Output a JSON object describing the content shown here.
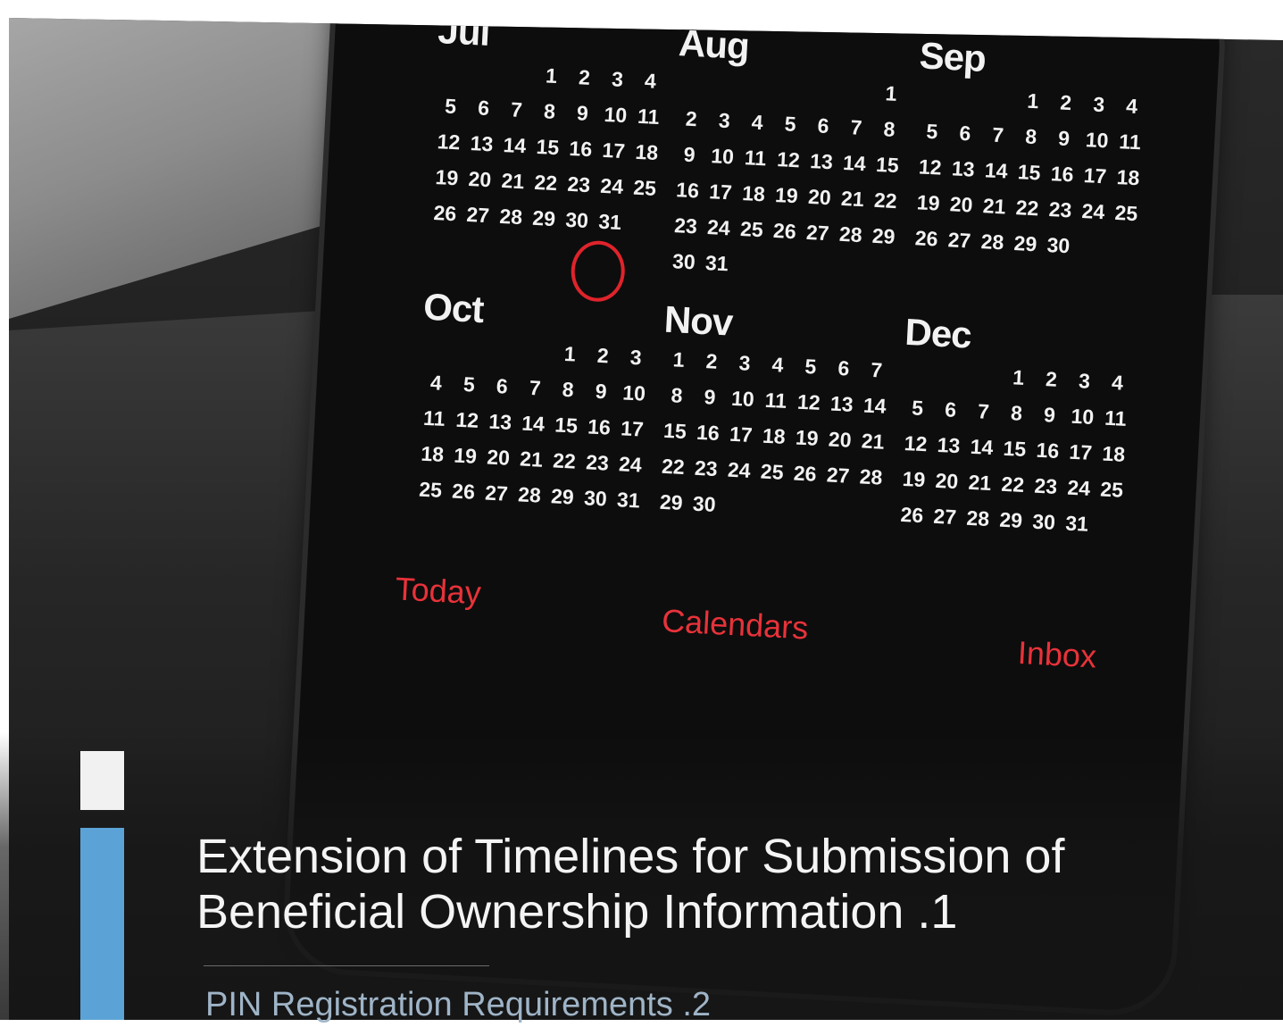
{
  "calendar": {
    "months": [
      {
        "id": "jul",
        "name": "Jul",
        "weeks": [
          [
            "",
            "",
            "",
            "1",
            "2",
            "3",
            "4"
          ],
          [
            "5",
            "6",
            "7",
            "8",
            "9",
            "10",
            "11"
          ],
          [
            "12",
            "13",
            "14",
            "15",
            "16",
            "17",
            "18"
          ],
          [
            "19",
            "20",
            "21",
            "22",
            "23",
            "24",
            "25"
          ],
          [
            "26",
            "27",
            "28",
            "29",
            "30",
            "31",
            ""
          ]
        ]
      },
      {
        "id": "aug",
        "name": "Aug",
        "weeks": [
          [
            "",
            "",
            "",
            "",
            "",
            "",
            "1"
          ],
          [
            "2",
            "3",
            "4",
            "5",
            "6",
            "7",
            "8"
          ],
          [
            "9",
            "10",
            "11",
            "12",
            "13",
            "14",
            "15"
          ],
          [
            "16",
            "17",
            "18",
            "19",
            "20",
            "21",
            "22"
          ],
          [
            "23",
            "24",
            "25",
            "26",
            "27",
            "28",
            "29"
          ],
          [
            "30",
            "31",
            "",
            "",
            "",
            "",
            ""
          ]
        ]
      },
      {
        "id": "sep",
        "name": "Sep",
        "weeks": [
          [
            "",
            "",
            "",
            "1",
            "2",
            "3",
            "4"
          ],
          [
            "5",
            "6",
            "7",
            "8",
            "9",
            "10",
            "11"
          ],
          [
            "12",
            "13",
            "14",
            "15",
            "16",
            "17",
            "18"
          ],
          [
            "19",
            "20",
            "21",
            "22",
            "23",
            "24",
            "25"
          ],
          [
            "26",
            "27",
            "28",
            "29",
            "30",
            "",
            ""
          ]
        ]
      },
      {
        "id": "oct",
        "name": "Oct",
        "weeks": [
          [
            "",
            "",
            "",
            "",
            "1",
            "2",
            "3"
          ],
          [
            "4",
            "5",
            "6",
            "7",
            "8",
            "9",
            "10"
          ],
          [
            "11",
            "12",
            "13",
            "14",
            "15",
            "16",
            "17"
          ],
          [
            "18",
            "19",
            "20",
            "21",
            "22",
            "23",
            "24"
          ],
          [
            "25",
            "26",
            "27",
            "28",
            "29",
            "30",
            "31"
          ]
        ]
      },
      {
        "id": "nov",
        "name": "Nov",
        "weeks": [
          [
            "1",
            "2",
            "3",
            "4",
            "5",
            "6",
            "7"
          ],
          [
            "8",
            "9",
            "10",
            "11",
            "12",
            "13",
            "14"
          ],
          [
            "15",
            "16",
            "17",
            "18",
            "19",
            "20",
            "21"
          ],
          [
            "22",
            "23",
            "24",
            "25",
            "26",
            "27",
            "28"
          ],
          [
            "29",
            "30",
            "",
            "",
            "",
            "",
            ""
          ]
        ]
      },
      {
        "id": "dec",
        "name": "Dec",
        "weeks": [
          [
            "",
            "",
            "",
            "1",
            "2",
            "3",
            "4"
          ],
          [
            "5",
            "6",
            "7",
            "8",
            "9",
            "10",
            "11"
          ],
          [
            "12",
            "13",
            "14",
            "15",
            "16",
            "17",
            "18"
          ],
          [
            "19",
            "20",
            "21",
            "22",
            "23",
            "24",
            "25"
          ],
          [
            "26",
            "27",
            "28",
            "29",
            "30",
            "31",
            ""
          ]
        ]
      }
    ],
    "highlighted": {
      "month": "Jul",
      "day": "31",
      "color": "#e0232b"
    },
    "nav": {
      "today": "Today",
      "calendars": "Calendars",
      "inbox": "Inbox"
    }
  },
  "agenda": {
    "item1": "Extension of Timelines for Submission of Beneficial Ownership Information .1",
    "item2": "PIN Registration Requirements .2"
  },
  "colors": {
    "accent_blue": "#5ba3d6",
    "accent_white": "#f1f1f1",
    "nav_red": "#e8323a"
  }
}
